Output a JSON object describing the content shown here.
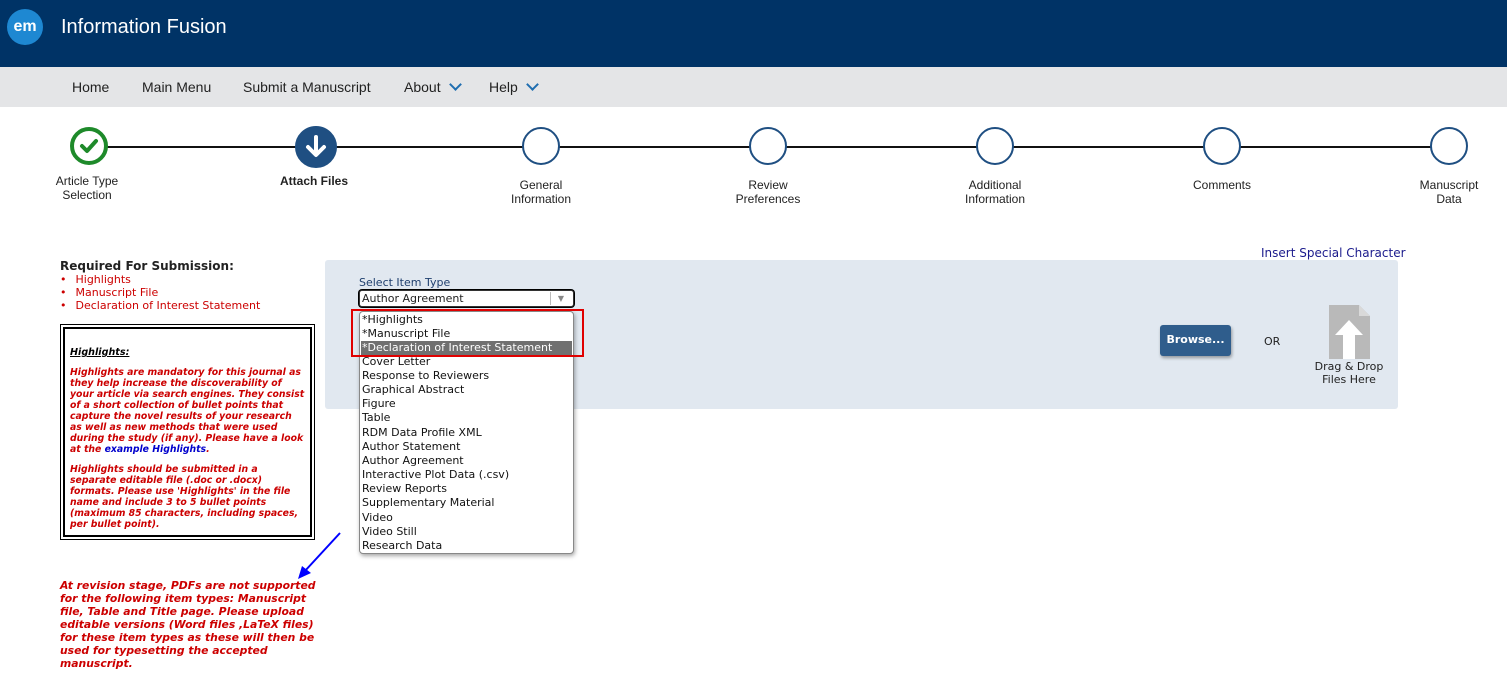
{
  "header": {
    "logo_text": "em",
    "app_title": "Information Fusion"
  },
  "nav": {
    "home": "Home",
    "main_menu": "Main Menu",
    "submit": "Submit a Manuscript",
    "about": "About",
    "help": "Help"
  },
  "steps": [
    {
      "line1": "Article Type",
      "line2": "Selection",
      "state": "done"
    },
    {
      "line1": "Attach Files",
      "line2": "",
      "state": "current"
    },
    {
      "line1": "General",
      "line2": "Information",
      "state": "todo"
    },
    {
      "line1": "Review",
      "line2": "Preferences",
      "state": "todo"
    },
    {
      "line1": "Additional",
      "line2": "Information",
      "state": "todo"
    },
    {
      "line1": "Comments",
      "line2": "",
      "state": "todo"
    },
    {
      "line1": "Manuscript",
      "line2": "Data",
      "state": "todo"
    }
  ],
  "required": {
    "title": "Required For Submission:",
    "items": [
      "Highlights",
      "Manuscript File",
      "Declaration of Interest Statement"
    ]
  },
  "infobox": {
    "heading": "Highlights:",
    "para1": "Highlights are mandatory for this journal as they help increase the discoverability of your article via search engines. They consist of a short collection of bullet points that capture the novel results of your research as well as new methods that were used during the study (if any). Please have a look at the",
    "link": "example Highlights",
    "para1_end": ".",
    "para2": "Highlights should be submitted in a separate editable file (.doc or .docx) formats. Please use 'Highlights' in the file name and include 3 to 5 bullet points (maximum 85 characters, including spaces, per bullet point)."
  },
  "revision_note": "At revision stage, PDFs are not supported for the following item types: Manuscript file, Table and Title page. Please upload editable versions (Word files ,LaTeX files) for these item types as these will then be used for typesetting the accepted manuscript.",
  "insert_special_char": "Insert Special Character",
  "upload": {
    "select_label": "Select Item Type",
    "selected_value": "Author Agreement",
    "browse_label": "Browse...",
    "or_label": "OR",
    "drop_label_1": "Drag & Drop",
    "drop_label_2": "Files Here"
  },
  "dropdown_options": [
    "*Highlights",
    "*Manuscript File",
    "*Declaration of Interest Statement",
    "Cover Letter",
    "Response to Reviewers",
    "Graphical Abstract",
    "Figure",
    "Table",
    "RDM Data Profile XML",
    "Author Statement",
    "Author Agreement",
    "Interactive Plot Data (.csv)",
    "Review Reports",
    "Supplementary Material",
    "Video",
    "Video Still",
    "Research Data"
  ],
  "dropdown_highlighted": "*Declaration of Interest Statement",
  "colors": {
    "header_bg": "#003366",
    "nav_bg": "#e4e5e7",
    "done_green": "#1e8a2a",
    "step_blue": "#1f4f82",
    "required_red": "#cc0000",
    "annotation_frame": "#e00000",
    "annotation_arrow": "#0000ff"
  }
}
